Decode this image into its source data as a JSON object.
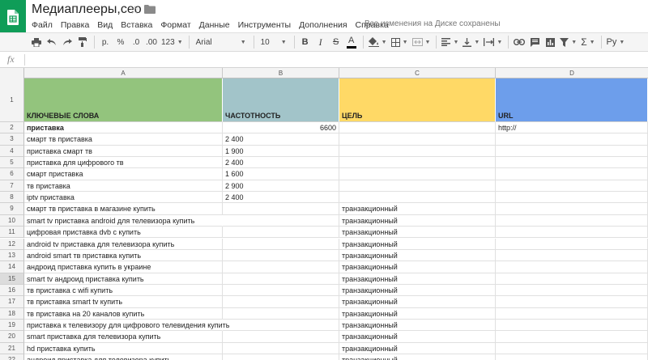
{
  "app": {
    "doc_title": "Медиаплееры,сео",
    "save_status": "Все изменения на Диске сохранены",
    "menu": [
      "Файл",
      "Правка",
      "Вид",
      "Вставка",
      "Формат",
      "Данные",
      "Инструменты",
      "Дополнения",
      "Справка"
    ]
  },
  "toolbar": {
    "currency": "р.",
    "percent": "%",
    "dec_decrease": ".0",
    "dec_increase": ".00",
    "more_formats": "123",
    "font": "Arial",
    "font_size": "10",
    "bold": "B",
    "italic": "I",
    "strike": "S",
    "text_color": "A",
    "input_tools": "Ру"
  },
  "formula": {
    "fx_label": "fx",
    "value": ""
  },
  "grid": {
    "columns": [
      "A",
      "B",
      "C",
      "D"
    ],
    "header_row": {
      "row_num": "1",
      "cells": [
        "КЛЮЧЕВЫЕ СЛОВА",
        "ЧАСТОТНОСТЬ",
        "ЦЕЛЬ",
        "URL"
      ],
      "colors": [
        "#93c47d",
        "#a2c4c9",
        "#ffd966",
        "#6d9eeb"
      ]
    },
    "rows": [
      {
        "n": "2",
        "a": "приставка",
        "b": "6600",
        "c": "",
        "d": "http://"
      },
      {
        "n": "3",
        "a": "смарт тв приставка",
        "b": "2 400",
        "c": "",
        "d": ""
      },
      {
        "n": "4",
        "a": "приставка смарт тв",
        "b": "1 900",
        "c": "",
        "d": ""
      },
      {
        "n": "5",
        "a": "приставка для цифрового тв",
        "b": "2 400",
        "c": "",
        "d": ""
      },
      {
        "n": "6",
        "a": "смарт приставка",
        "b": "1 600",
        "c": "",
        "d": ""
      },
      {
        "n": "7",
        "a": "тв приставка",
        "b": "2 900",
        "c": "",
        "d": ""
      },
      {
        "n": "8",
        "a": "iptv приставка",
        "b": "2 400",
        "c": "",
        "d": ""
      },
      {
        "n": "9",
        "a": "смарт тв приставка в магазине купить",
        "b": "",
        "c": "транзакционный",
        "d": ""
      },
      {
        "n": "10",
        "a": "smart tv приставка android для телевизора купить",
        "b": "",
        "c": "транзакционный",
        "d": ""
      },
      {
        "n": "11",
        "a": "цифровая приставка dvb с купить",
        "b": "",
        "c": "транзакционный",
        "d": ""
      },
      {
        "n": "12",
        "a": "android tv приставка для телевизора купить",
        "b": "",
        "c": "транзакционный",
        "d": ""
      },
      {
        "n": "13",
        "a": "android smart тв приставка купить",
        "b": "",
        "c": "транзакционный",
        "d": ""
      },
      {
        "n": "14",
        "a": "андроид приставка купить в украине",
        "b": "",
        "c": "транзакционный",
        "d": ""
      },
      {
        "n": "15",
        "a": "smart tv андроид приставка купить",
        "b": "",
        "c": "транзакционный",
        "d": ""
      },
      {
        "n": "16",
        "a": "тв приставка с wifi купить",
        "b": "",
        "c": "транзакционный",
        "d": ""
      },
      {
        "n": "17",
        "a": "тв приставка smart tv купить",
        "b": "",
        "c": "транзакционный",
        "d": ""
      },
      {
        "n": "18",
        "a": "тв приставка на 20 каналов купить",
        "b": "",
        "c": "транзакционный",
        "d": ""
      },
      {
        "n": "19",
        "a": "приставка к телевизору для цифрового телевидения купить",
        "b": "",
        "c": "транзакционный",
        "d": ""
      },
      {
        "n": "20",
        "a": "smart приставка для телевизора купить",
        "b": "",
        "c": "транзакционный",
        "d": ""
      },
      {
        "n": "21",
        "a": "hd приставка купить",
        "b": "",
        "c": "транзакционный",
        "d": ""
      },
      {
        "n": "22",
        "a": "андроид приставка для телевизора купить",
        "b": "",
        "c": "транзакционный",
        "d": ""
      }
    ]
  }
}
